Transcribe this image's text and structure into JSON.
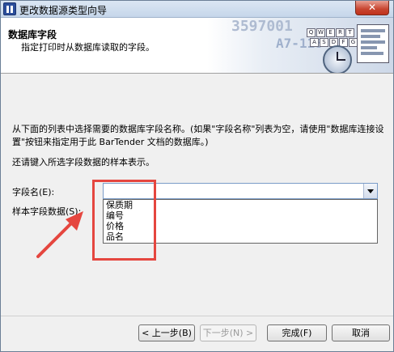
{
  "window": {
    "title": "更改数据源类型向导",
    "close_symbol": "✕"
  },
  "header": {
    "title": "数据库字段",
    "subtitle": "指定打印时从数据库读取的字段。",
    "art": {
      "barcode_text_1": "3597001",
      "barcode_text_2": "A7-118",
      "keys_row1": [
        "Q",
        "W",
        "E",
        "R",
        "T"
      ],
      "keys_row2": [
        "A",
        "S",
        "D",
        "F",
        "G"
      ]
    }
  },
  "body": {
    "instruction": "从下面的列表中选择需要的数据库字段名称。(如果\"字段名称\"列表为空，请使用\"数据库连接设置\"按钮来指定用于此 BarTender 文档的数据库。)",
    "sample_instruction": "还请键入所选字段数据的样本表示。",
    "field_label": "字段名(E):",
    "sample_label": "样本字段数据(S):",
    "field_value": "",
    "dropdown_options": [
      "保质期",
      "编号",
      "价格",
      "品名"
    ]
  },
  "annotation": {
    "highlight_color": "#e5463f"
  },
  "buttons": {
    "back": "< 上一步(B)",
    "next": "下一步(N) >",
    "finish": "完成(F)",
    "cancel": "取消"
  }
}
